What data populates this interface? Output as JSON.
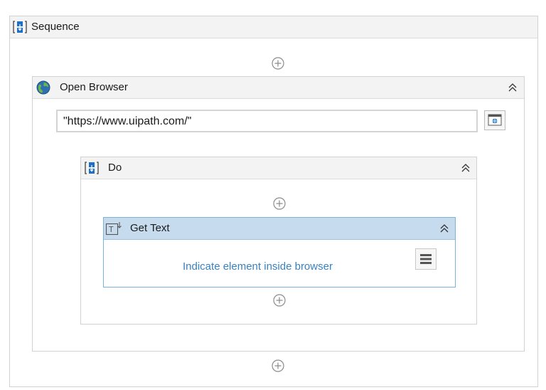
{
  "sequence": {
    "title": "Sequence",
    "icon": "sequence-icon"
  },
  "open_browser": {
    "title": "Open Browser",
    "icon": "globe-icon",
    "url": "\"https://www.uipath.com/\"",
    "browser_button_icon": "browser-window-icon"
  },
  "do": {
    "title": "Do",
    "icon": "sequence-icon"
  },
  "get_text": {
    "title": "Get Text",
    "icon": "get-text-icon",
    "indicate_label": "Indicate element inside browser",
    "menu_icon": "hamburger-menu-icon"
  },
  "colors": {
    "header_bg": "#f3f3f3",
    "border": "#d2d2d2",
    "selected_header": "#c6dcee",
    "selected_border": "#7fb2d9",
    "link": "#3a82c0"
  }
}
